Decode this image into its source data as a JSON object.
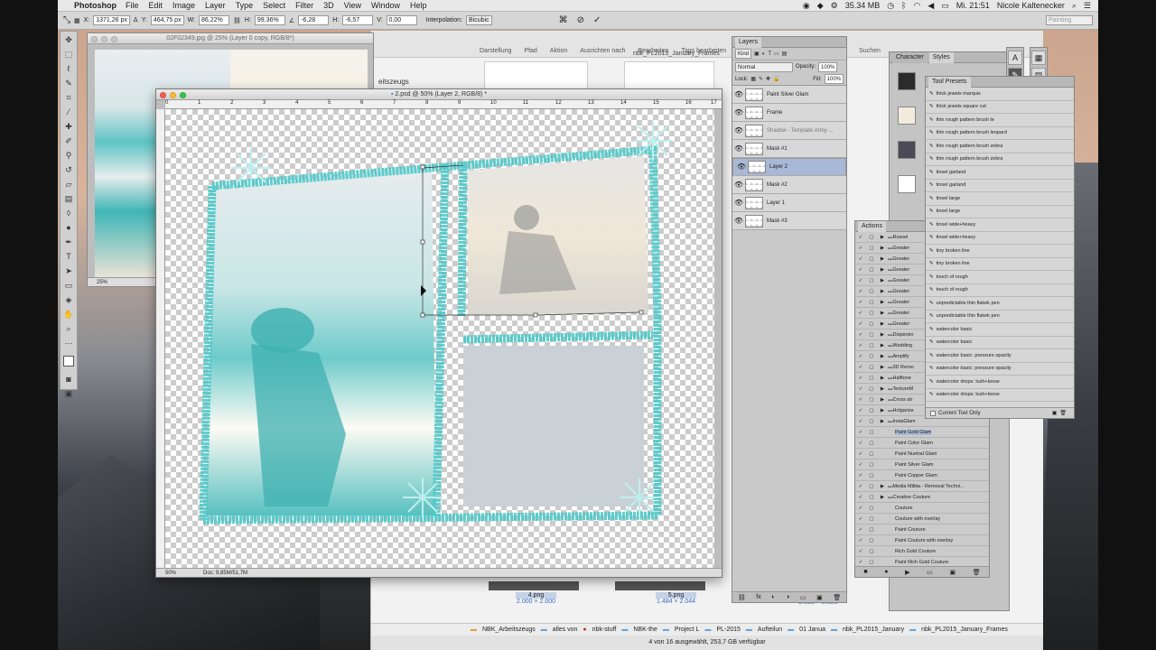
{
  "menubar": {
    "app": "Photoshop",
    "items": [
      "File",
      "Edit",
      "Image",
      "Layer",
      "Type",
      "Select",
      "Filter",
      "3D",
      "View",
      "Window",
      "Help"
    ],
    "memory": "35.34 MB",
    "clock": "Mi. 21:51",
    "user": "Nicole Kaltenecker"
  },
  "options": {
    "x": "1371,26 px",
    "y": "464,75 px",
    "w": "86,22%",
    "h": "99,36%",
    "angle": "-6,28",
    "hskew": "-6,57",
    "vskew": "0,00",
    "interp_label": "Interpolation:",
    "interp_value": "Bicubic",
    "workspace": "Painting"
  },
  "finder": {
    "toolbar": [
      "Darstellung",
      "Pfad",
      "Aktion",
      "Ausrichten nach",
      "Bearbeiten",
      "Tags bearbeiten",
      "Ne"
    ],
    "search": "Suchen",
    "folder_title": "nbk_PL2015_January_Frames",
    "files": [
      {
        "name": "4.png",
        "size": "2.000 × 2.000"
      },
      {
        "name": "5.png",
        "size": "1.484 × 2.044"
      },
      {
        "name": "",
        "size": "2.028 × 2.028"
      }
    ],
    "path": [
      "NBK_Arbeitszeugs",
      "alles von",
      "nbk-stuff",
      "NBK-the",
      "Project L",
      "PL-2015",
      "Aufteilun",
      "01 Janua",
      "nbk_PL2015_January",
      "nbk_PL2015_January_Frames"
    ],
    "status": "4 von 16 ausgewählt, 253,7 GB verfügbar",
    "sidebar_item": "eitszeugs"
  },
  "doc_small": {
    "title": "02F02349.jpg @ 25% (Layer 0 copy, RGB/8*)",
    "zoom": "25%"
  },
  "doc_main": {
    "title": "2.psd @ 50% (Layer 2, RGB/8) *",
    "zoom": "50%",
    "doc_info": "Doc: 9,85M/51,7M",
    "ruler": [
      "0",
      "1",
      "2",
      "3",
      "4",
      "5",
      "6",
      "7",
      "8",
      "9",
      "10",
      "11",
      "12",
      "13",
      "14",
      "15",
      "16",
      "17"
    ]
  },
  "layers": {
    "tab": "Layers",
    "filter": "Kind",
    "blend": "Normal",
    "opacity_label": "Opacity:",
    "opacity": "100%",
    "lock_label": "Lock:",
    "fill_label": "Fill:",
    "fill": "100%",
    "rows": [
      {
        "name": "Paint Silver Glam",
        "selected": false
      },
      {
        "name": "Frame",
        "selected": false
      },
      {
        "name": "Shadow - Template Army ...",
        "selected": false
      },
      {
        "name": "Mask #1",
        "selected": false
      },
      {
        "name": "Layer 2",
        "selected": true
      },
      {
        "name": "Mask #2",
        "selected": false
      },
      {
        "name": "Layer 1",
        "selected": false
      },
      {
        "name": "Mask #3",
        "selected": false
      }
    ],
    "footer": [
      "⛓",
      "fx",
      "◐",
      "◑",
      "▭",
      "▣",
      "🗑"
    ]
  },
  "styles_panel": {
    "tabs": [
      "Character",
      "Styles"
    ],
    "swatches": [
      "#2b2b2b",
      "#f1ecdc",
      "#4d4a57",
      "#ffffff"
    ]
  },
  "presets": {
    "tab": "Tool Presets",
    "items": [
      "thick jewels marquis",
      "thick jewels square cut",
      "thin rough pattern brush le",
      "thin rough pattern brush leopard",
      "thin rough pattern brush zebra",
      "thin rough pattern brush zebra",
      "tinsel garland",
      "tinsel garland",
      "tinsel large",
      "tinsel large",
      "tinsel wide+heavy",
      "tinsel wide+heavy",
      "tiny broken line",
      "tiny broken line",
      "touch of rough",
      "touch of rough",
      "unpredictable thin flakek pen",
      "unpredictable thin flakek pen",
      "watercolor basic",
      "watercolor basic",
      "watercolor basic: pressure opacity",
      "watercolor basic: pressure opacity",
      "watercolor drops: lush+loose",
      "watercolor drops: lush+loose"
    ],
    "footer": "Current Tool Only"
  },
  "actions": {
    "tab": "Actions",
    "items": [
      {
        "name": "Russel",
        "folder": true
      },
      {
        "name": "Greater",
        "folder": true
      },
      {
        "name": "Greater",
        "folder": true
      },
      {
        "name": "Greater",
        "folder": true
      },
      {
        "name": "Greater",
        "folder": true
      },
      {
        "name": "Greater",
        "folder": true
      },
      {
        "name": "Greater",
        "folder": true
      },
      {
        "name": "Greater",
        "folder": true
      },
      {
        "name": "Greater",
        "folder": true
      },
      {
        "name": "Dispersio",
        "folder": true
      },
      {
        "name": "Wedding",
        "folder": true
      },
      {
        "name": "Amplify",
        "folder": true
      },
      {
        "name": "3D Remo",
        "folder": true
      },
      {
        "name": "Halftone",
        "folder": true
      },
      {
        "name": "TextureM",
        "folder": true
      },
      {
        "name": "Cross str",
        "folder": true
      },
      {
        "name": "Holgarize",
        "folder": true
      },
      {
        "name": "InstaGlam",
        "folder": true
      },
      {
        "name": "Paint Gold Glam",
        "folder": false,
        "hl": true
      },
      {
        "name": "Paint Color Glam",
        "folder": false
      },
      {
        "name": "Paint Nuetral Glam",
        "folder": false
      },
      {
        "name": "Paint Silver Glam",
        "folder": false
      },
      {
        "name": "Paint Copper Glam",
        "folder": false
      },
      {
        "name": "Media Militia - Removal Techni...",
        "folder": true
      },
      {
        "name": "Creative Couture",
        "folder": true
      },
      {
        "name": "Couture",
        "folder": false
      },
      {
        "name": "Couture with overlay",
        "folder": false
      },
      {
        "name": "Paint Couture",
        "folder": false
      },
      {
        "name": "Paint Couture with overlay",
        "folder": false
      },
      {
        "name": "Rich Gold Couture",
        "folder": false
      },
      {
        "name": "Paint Rich Gold Couture",
        "folder": false
      }
    ]
  },
  "colors": {
    "accent": "#a9b8d6",
    "frame_glitter": "#4ec9c9",
    "menubar_bg": "#e8e8e8"
  }
}
